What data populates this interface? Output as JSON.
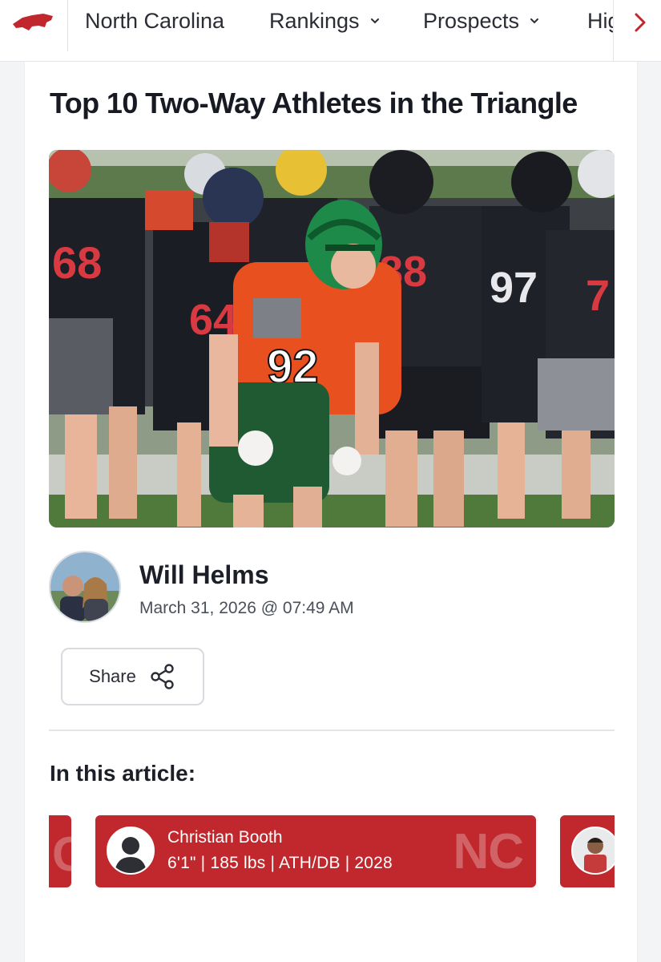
{
  "nav": {
    "items": [
      {
        "label": "North Carolina",
        "has_dropdown": false
      },
      {
        "label": "Rankings",
        "has_dropdown": true
      },
      {
        "label": "Prospects",
        "has_dropdown": true
      },
      {
        "label": "Hig",
        "has_dropdown": false
      }
    ],
    "logo_icon": "north-carolina-state-shape-icon",
    "next_icon": "chevron-right-icon",
    "accent_color": "#c0282d"
  },
  "article": {
    "title": "Top 10 Two-Way Athletes in the Triangle",
    "author": "Will Helms",
    "date": "March 31, 2026 @ 07:49 AM",
    "share_label": "Share",
    "share_icon": "share-icon"
  },
  "in_article": {
    "heading": "In this article:",
    "players": [
      {
        "name": "Christian Booth",
        "details": "6'1\" | 185 lbs | ATH/DB | 2028",
        "state": "NC"
      }
    ]
  }
}
